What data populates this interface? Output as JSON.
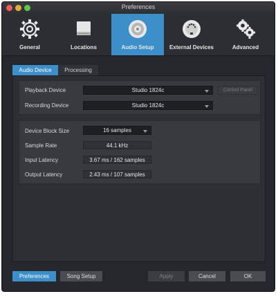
{
  "window": {
    "title": "Preferences"
  },
  "toolbar": {
    "items": [
      {
        "label": "General",
        "icon": "gear-icon"
      },
      {
        "label": "Locations",
        "icon": "hard-drive-icon"
      },
      {
        "label": "Audio Setup",
        "icon": "speaker-icon"
      },
      {
        "label": "External Devices",
        "icon": "midi-port-icon"
      },
      {
        "label": "Advanced",
        "icon": "gears-icon"
      }
    ],
    "active_index": 2
  },
  "tabs": [
    {
      "label": "Audio Device"
    },
    {
      "label": "Processing"
    }
  ],
  "device": {
    "playback_label": "Playback Device",
    "playback_value": "Studio 1824c",
    "control_panel": "Control Panel",
    "recording_label": "Recording Device",
    "recording_value": "Studio 1824c"
  },
  "settings": {
    "block_size_label": "Device Block Size",
    "block_size_value": "16 samples",
    "sample_rate_label": "Sample Rate",
    "sample_rate_value": "44.1 kHz",
    "input_latency_label": "Input Latency",
    "input_latency_value": "3.67 ms / 162 samples",
    "output_latency_label": "Output Latency",
    "output_latency_value": "2.43 ms / 107 samples"
  },
  "footer": {
    "preferences": "Preferences",
    "song_setup": "Song Setup",
    "apply": "Apply",
    "cancel": "Cancel",
    "ok": "OK"
  },
  "colors": {
    "accent": "#3d8fc9",
    "window_bg": "#25272c",
    "panel_bg": "#383a40"
  }
}
